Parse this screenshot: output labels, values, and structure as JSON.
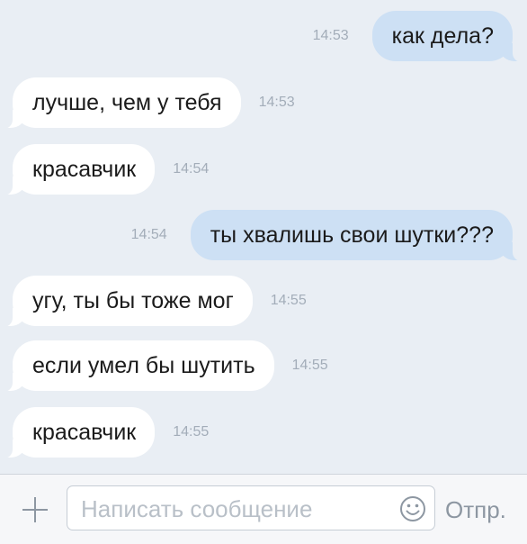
{
  "messages": [
    {
      "side": "out",
      "text": "как дела?",
      "time": "14:53"
    },
    {
      "side": "in",
      "text": "лучше, чем у тебя",
      "time": "14:53"
    },
    {
      "side": "in",
      "text": "красавчик",
      "time": "14:54"
    },
    {
      "side": "out",
      "text": "ты хвалишь свои шутки???",
      "time": "14:54"
    },
    {
      "side": "in",
      "text": "угу, ты бы тоже мог",
      "time": "14:55"
    },
    {
      "side": "in",
      "text": "если умел бы шутить",
      "time": "14:55"
    },
    {
      "side": "in",
      "text": "красавчик",
      "time": "14:55"
    }
  ],
  "composer": {
    "placeholder": "Написать сообщение",
    "send_label": "Отпр.",
    "attach_icon": "plus-icon",
    "emoji_icon": "smile-icon"
  },
  "colors": {
    "background": "#e9eef4",
    "incoming_bubble": "#ffffff",
    "outgoing_bubble": "#cde0f4",
    "timestamp": "#a3adb9"
  }
}
